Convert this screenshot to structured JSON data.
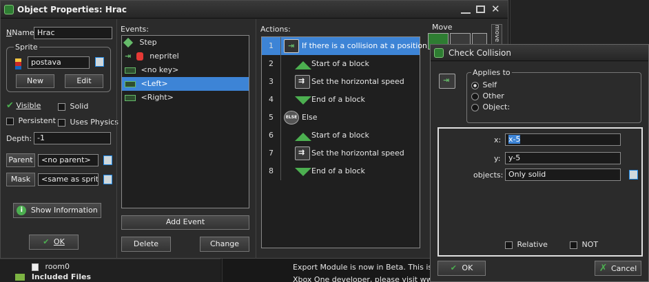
{
  "object_window": {
    "title": "Object Properties: Hrac",
    "name_label": "Name:",
    "name_value": "Hrac",
    "sprite_group": "Sprite",
    "sprite_value": "postava",
    "new_label": "New",
    "edit_label": "Edit",
    "visible_label": "Visible",
    "solid_label": "Solid",
    "persistent_label": "Persistent",
    "physics_label": "Uses Physics",
    "depth_label": "Depth:",
    "depth_value": "-1",
    "parent_label": "Parent",
    "parent_value": "<no parent>",
    "mask_label": "Mask",
    "mask_value": "<same as sprite>",
    "show_info_label": "Show Information",
    "ok_label": "OK",
    "visible_checked": true,
    "solid_checked": false,
    "persistent_checked": false,
    "physics_checked": false
  },
  "events": {
    "header": "Events:",
    "items": [
      {
        "label": "Step",
        "icon": "step-icon"
      },
      {
        "label": "nepritel",
        "icon": "collision-icon"
      },
      {
        "label": "<no key>",
        "icon": "keyboard-icon"
      },
      {
        "label": "<Left>",
        "icon": "keyboard-icon",
        "selected": true
      },
      {
        "label": "<Right>",
        "icon": "keyboard-icon"
      }
    ],
    "add_event_label": "Add Event",
    "delete_label": "Delete",
    "change_label": "Change"
  },
  "actions": {
    "header": "Actions:",
    "items": [
      {
        "num": "1",
        "label": "If there is a collision at a position",
        "icon": "check-collision-icon",
        "selected": true
      },
      {
        "num": "2",
        "label": "Start of a block",
        "icon": "start-block-icon"
      },
      {
        "num": "3",
        "label": "Set the horizontal speed",
        "icon": "horizontal-speed-icon"
      },
      {
        "num": "4",
        "label": "End of a block",
        "icon": "end-block-icon"
      },
      {
        "num": "5",
        "label": "Else",
        "icon": "else-icon"
      },
      {
        "num": "6",
        "label": "Start of a block",
        "icon": "start-block-icon"
      },
      {
        "num": "7",
        "label": "Set the horizontal speed",
        "icon": "horizontal-speed-icon"
      },
      {
        "num": "8",
        "label": "End of a block",
        "icon": "end-block-icon"
      }
    ]
  },
  "move_tab": {
    "label": "Move",
    "side_label": "move"
  },
  "check_collision": {
    "title": "Check Collision",
    "applies_to_label": "Applies to",
    "options": [
      "Self",
      "Other",
      "Object:"
    ],
    "selected_option": "Self",
    "x_label": "x:",
    "x_value": "x-5",
    "y_label": "y:",
    "y_value": "y-5",
    "objects_label": "objects:",
    "objects_value": "Only solid",
    "relative_label": "Relative",
    "not_label": "NOT",
    "ok_label": "OK",
    "cancel_label": "Cancel"
  },
  "background": {
    "tree_items": [
      "room0",
      "Included Files"
    ],
    "message_line1": "Export Module is now in Beta. This is ava",
    "message_line2": "Xbox One developer, please visit www.x"
  },
  "colors": {
    "selection": "#3d84d6",
    "accent_green": "#4caf50",
    "cancel_red": "#e53935"
  }
}
